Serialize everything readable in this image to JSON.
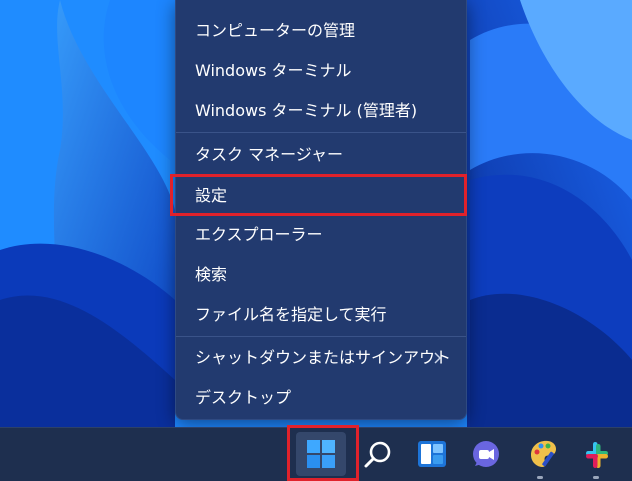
{
  "menu": {
    "items": [
      {
        "label": "コンピューターの管理"
      },
      {
        "label": "Windows ターミナル"
      },
      {
        "label": "Windows ターミナル (管理者)"
      },
      {
        "label": "タスク マネージャー"
      },
      {
        "label": "設定"
      },
      {
        "label": "エクスプローラー"
      },
      {
        "label": "検索"
      },
      {
        "label": "ファイル名を指定して実行"
      },
      {
        "label": "シャットダウンまたはサインアウト"
      },
      {
        "label": "デスクトップ"
      }
    ],
    "submenu_icon": "chevron-right-icon"
  },
  "taskbar": {
    "icons": [
      "windows-start-icon",
      "search-icon",
      "widgets-icon",
      "teams-chat-icon",
      "paint-icon",
      "slack-icon"
    ]
  },
  "colors": {
    "highlight": "#e0222b",
    "menu_bg": "#223a6f",
    "taskbar_bg": "#1e2f4f"
  }
}
